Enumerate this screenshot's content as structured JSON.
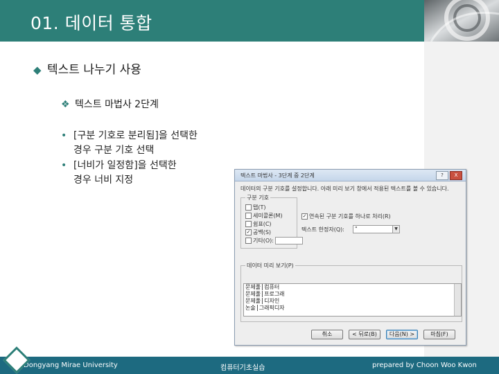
{
  "header": {
    "title": "01. 데이터 통합"
  },
  "bullets": {
    "l1": "텍스트 나누기 사용",
    "l2": "텍스트 마법사 2단계",
    "items": [
      {
        "line1": "[구분 기호로 분리됨]을 선택한",
        "line2": "경우 구분 기호 선택"
      },
      {
        "line1": "[너비가 일정함]을 선택한",
        "line2": "경우 너비 지정"
      }
    ]
  },
  "dialog": {
    "title": "텍스트 마법사 - 3단계 중 2단계",
    "help_btn": "?",
    "close_btn": "X",
    "description": "데이터의 구분 기호를 설정합니다. 아래 미리 보기 창에서 적용된 텍스트를 볼 수 있습니다.",
    "delim_group_label": "구분 기호",
    "delimiters": [
      {
        "label": "탭(T)",
        "checked": false
      },
      {
        "label": "세미콜론(M)",
        "checked": false
      },
      {
        "label": "쉼표(C)",
        "checked": false
      },
      {
        "label": "공백(S)",
        "checked": true
      },
      {
        "label": "기타(O):",
        "checked": false
      }
    ],
    "consecutive_label": "연속된 구분 기호를 하나로 처리(R)",
    "consecutive_checked": true,
    "qualifier_label": "텍스트 한정자(Q):",
    "qualifier_value": "\"",
    "preview_label": "데이터 미리 보기(P)",
    "preview_rows": [
      [
        "문제풀",
        "컴퓨터"
      ],
      [
        "문제풀",
        "프로그래"
      ],
      [
        "문제풀",
        "디자인"
      ],
      [
        "논술",
        "그래픽디자"
      ]
    ],
    "buttons": {
      "cancel": "취소",
      "back": "< 뒤로(B)",
      "next": "다음(N) >",
      "finish": "마침(F)"
    }
  },
  "footer": {
    "left": "Dongyang Mirae University",
    "center": "컴퓨터기초실습",
    "right": "prepared by Choon Woo Kwon"
  },
  "colors": {
    "header": "#2d7f78",
    "footer": "#1d6a80"
  }
}
